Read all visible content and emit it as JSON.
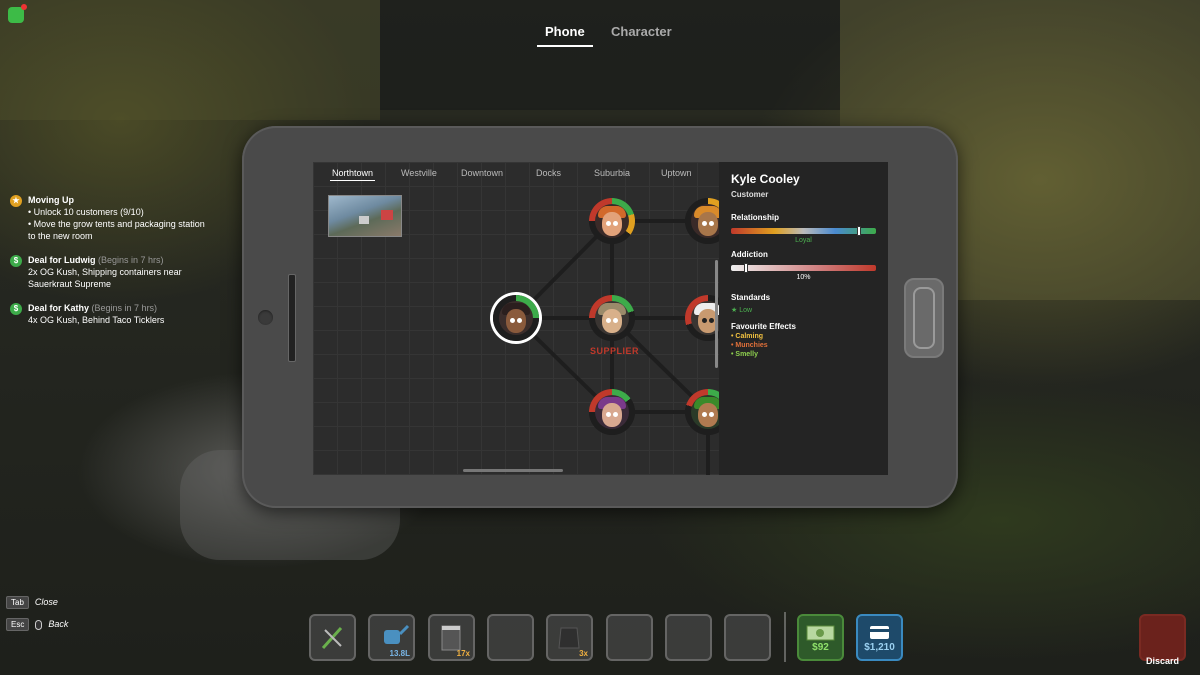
{
  "top_tabs": [
    {
      "label": "Phone",
      "active": true
    },
    {
      "label": "Character",
      "active": false
    }
  ],
  "quests": [
    {
      "icon": "star-icon",
      "title": "Moving Up",
      "subtitle": "",
      "lines": [
        "• Unlock 10 customers (9/10)",
        "• Move the grow tents and packaging station to the new room"
      ],
      "color": "#e0a020"
    },
    {
      "icon": "deal-icon",
      "title": "Deal for Ludwig",
      "subtitle": "(Begins in 7 hrs)",
      "lines": [
        "2x OG Kush, Shipping containers near Sauerkraut Supreme"
      ],
      "color": "#3dab4a"
    },
    {
      "icon": "deal-icon",
      "title": "Deal for Kathy",
      "subtitle": "(Begins in 7 hrs)",
      "lines": [
        "4x OG Kush, Behind Taco Ticklers"
      ],
      "color": "#3dab4a"
    }
  ],
  "region_tabs": [
    "Northtown",
    "Westville",
    "Downtown",
    "Docks",
    "Suburbia",
    "Uptown"
  ],
  "active_region": "Northtown",
  "map": {
    "supplier_label": "SUPPLIER"
  },
  "contact": {
    "name": "Kyle Cooley",
    "role": "Customer",
    "relationship_label": "Relationship",
    "relationship_value": "Loyal",
    "relationship_level": 0.88,
    "addiction_label": "Addiction",
    "addiction_value": "10%",
    "addiction_level": 0.1,
    "standards_label": "Standards",
    "standards_value": "Low",
    "favourite_label": "Favourite Effects",
    "effects": [
      {
        "text": "• Calming",
        "color": "#f0c040"
      },
      {
        "text": "• Munchies",
        "color": "#e0703a"
      },
      {
        "text": "• Smelly",
        "color": "#8fd14f"
      }
    ]
  },
  "key_hints": [
    {
      "key": "Tab",
      "action": "Close"
    },
    {
      "key": "Esc",
      "action": "Back"
    }
  ],
  "hotbar": [
    {
      "icon": "trimmers-icon",
      "count": ""
    },
    {
      "icon": "watering-can-icon",
      "count": "13.8L"
    },
    {
      "icon": "packaging-icon",
      "count": "17x"
    },
    {
      "icon": "",
      "count": ""
    },
    {
      "icon": "bag-icon",
      "count": "3x"
    },
    {
      "icon": "",
      "count": ""
    },
    {
      "icon": "",
      "count": ""
    },
    {
      "icon": "",
      "count": ""
    }
  ],
  "cash": "$92",
  "bank": "$1,210",
  "discard_label": "Discard"
}
